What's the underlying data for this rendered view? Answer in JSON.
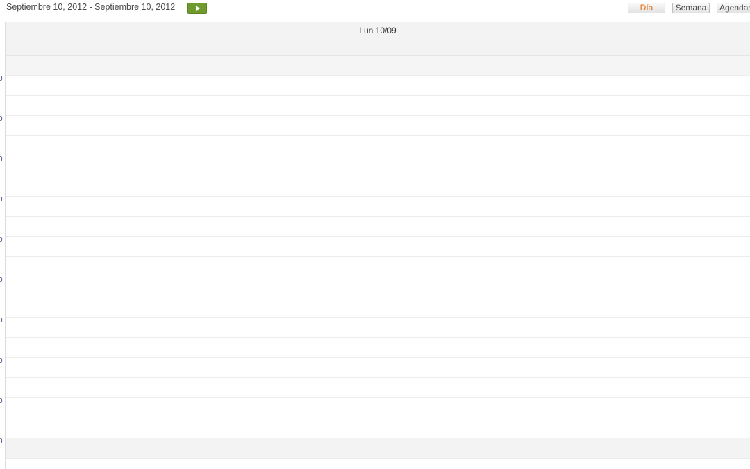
{
  "toolbar": {
    "date_range": "Septiembre 10, 2012 - Septiembre 10, 2012",
    "next_icon": "play-icon",
    "views": {
      "day": "Día",
      "week": "Semana",
      "agendas": "Agendas"
    },
    "active_view": "day"
  },
  "calendar": {
    "day_header": "Lun 10/09",
    "hour_label_suffix": "0",
    "hour_labels": [
      "0",
      "0",
      "0",
      "0",
      "0",
      "0",
      "0",
      "0",
      "0",
      "0"
    ]
  },
  "colors": {
    "accent_active": "#e36c0a",
    "next_button": "#6f9a2e",
    "header_bg": "#f3f3f3",
    "time_label": "#3a4f7a"
  }
}
